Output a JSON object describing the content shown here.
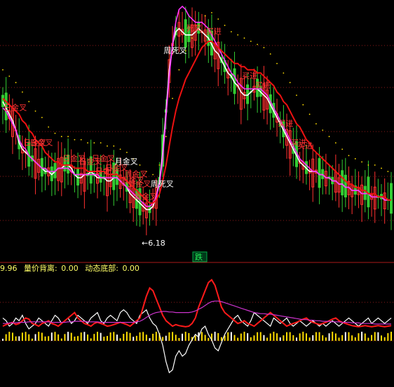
{
  "colors": {
    "background": "#000000",
    "grid": "#8b1a1a",
    "up_candle": "#ff3030",
    "down_candle": "#33cc33",
    "ma_white": "#ffffff",
    "ma_magenta": "#ff33ff",
    "ma_red": "#ee1111",
    "signal_dot": "#ffdd00",
    "panel_title": "#ffff66",
    "sell_box": "#00aa44",
    "label_red": "#ff3333",
    "label_white": "#ffffff"
  },
  "main_panel": {
    "low_value_label": "←6.18",
    "sell_badge": "跌",
    "signal_labels": [
      {
        "text": "日金叉",
        "color": "red"
      },
      {
        "text": "日金叉",
        "color": "red"
      },
      {
        "text": "日金叉",
        "color": "red"
      },
      {
        "text": "日金叉",
        "color": "red"
      },
      {
        "text": "日金叉",
        "color": "red"
      },
      {
        "text": "日金叉",
        "color": "red"
      },
      {
        "text": "日金叉",
        "color": "red"
      },
      {
        "text": "日金叉",
        "color": "red"
      },
      {
        "text": "月金叉",
        "color": "white"
      },
      {
        "text": "周金叉",
        "color": "red"
      },
      {
        "text": "周金叉",
        "color": "red"
      },
      {
        "text": "周金叉",
        "color": "red"
      },
      {
        "text": "周金叉",
        "color": "red"
      },
      {
        "text": "周死叉",
        "color": "white"
      },
      {
        "text": "周死叉",
        "color": "white"
      },
      {
        "text": "死叉",
        "color": "red"
      },
      {
        "text": "买进",
        "color": "red"
      },
      {
        "text": "买进",
        "color": "red"
      },
      {
        "text": "买进",
        "color": "red"
      },
      {
        "text": "买进",
        "color": "red"
      },
      {
        "text": "买进",
        "color": "red"
      },
      {
        "text": "买进",
        "color": "red"
      }
    ]
  },
  "sub_panel": {
    "header_prefix": "9.96",
    "indicator1_label": "量价背离:",
    "indicator1_value": "0.00",
    "indicator2_label": "动态底部:",
    "indicator2_value": "0.00"
  },
  "chart_data": [
    {
      "type": "line",
      "panel": "price",
      "ylim": [
        4.8,
        13.0
      ],
      "x": [
        0,
        1,
        2,
        3,
        4,
        5,
        6,
        7,
        8,
        9,
        10,
        11,
        12,
        13,
        14,
        15,
        16,
        17,
        18,
        19,
        20,
        21,
        22,
        23,
        24,
        25,
        26,
        27,
        28,
        29,
        30,
        31,
        32,
        33,
        34,
        35,
        36,
        37,
        38,
        39,
        40,
        41,
        42,
        43,
        44,
        45,
        46,
        47,
        48,
        49,
        50,
        51,
        52,
        53,
        54,
        55,
        56,
        57,
        58,
        59,
        60,
        61,
        62,
        63,
        64,
        65,
        66,
        67,
        68,
        69,
        70,
        71,
        72,
        73,
        74,
        75,
        76,
        77,
        78,
        79,
        80,
        81,
        82,
        83,
        84,
        85,
        86,
        87,
        88,
        89,
        90,
        91,
        92,
        93,
        94,
        95,
        96,
        97,
        98,
        99,
        100,
        101,
        102,
        103,
        104,
        105,
        106,
        107,
        108,
        109,
        110,
        111,
        112,
        113,
        114,
        115,
        116,
        117,
        118,
        119
      ],
      "series": [
        {
          "color": "white",
          "values": [
            9.8,
            9.6,
            9.4,
            9.2,
            8.9,
            8.5,
            8.3,
            8.2,
            8.1,
            8.0,
            7.9,
            7.8,
            7.7,
            7.6,
            7.6,
            7.5,
            7.6,
            7.7,
            7.7,
            7.8,
            7.8,
            7.7,
            7.5,
            7.4,
            7.4,
            7.5,
            7.5,
            7.6,
            7.5,
            7.4,
            7.4,
            7.4,
            7.3,
            7.3,
            7.4,
            7.4,
            7.3,
            7.2,
            7.1,
            6.9,
            6.8,
            6.7,
            6.6,
            6.5,
            6.4,
            6.4,
            6.5,
            6.8,
            7.3,
            8.2,
            9.5,
            10.8,
            11.6,
            12.0,
            12.1,
            12.0,
            11.9,
            11.9,
            11.9,
            12.0,
            12.1,
            12.0,
            11.9,
            11.8,
            11.6,
            11.4,
            11.3,
            11.1,
            10.9,
            10.7,
            10.6,
            10.4,
            10.3,
            10.1,
            10.0,
            10.0,
            10.1,
            10.2,
            10.2,
            10.1,
            10.0,
            9.9,
            9.7,
            9.5,
            9.3,
            9.1,
            8.9,
            8.7,
            8.5,
            8.3,
            8.1,
            7.9,
            7.8,
            7.7,
            7.6,
            7.6,
            7.6,
            7.5,
            7.5,
            7.4,
            7.4,
            7.3,
            7.3,
            7.2,
            7.2,
            7.1,
            7.1,
            7.0,
            7.0,
            7.0,
            6.9,
            6.9,
            6.9,
            6.8,
            6.8,
            6.8,
            6.8,
            6.7,
            6.7,
            6.7
          ]
        },
        {
          "color": "magenta",
          "values": [
            9.6,
            9.5,
            9.3,
            9.1,
            8.9,
            8.6,
            8.4,
            8.3,
            8.1,
            8.0,
            7.9,
            7.8,
            7.7,
            7.7,
            7.6,
            7.6,
            7.6,
            7.7,
            7.7,
            7.7,
            7.7,
            7.6,
            7.5,
            7.5,
            7.5,
            7.5,
            7.5,
            7.5,
            7.5,
            7.5,
            7.4,
            7.4,
            7.4,
            7.4,
            7.4,
            7.4,
            7.3,
            7.2,
            7.1,
            7.0,
            6.9,
            6.8,
            6.7,
            6.6,
            6.5,
            6.5,
            6.6,
            6.8,
            7.2,
            8.0,
            9.3,
            10.6,
            11.6,
            12.3,
            12.7,
            12.8,
            12.7,
            12.5,
            12.4,
            12.3,
            12.3,
            12.3,
            12.2,
            12.1,
            11.9,
            11.7,
            11.5,
            11.3,
            11.1,
            10.9,
            10.7,
            10.6,
            10.4,
            10.3,
            10.2,
            10.2,
            10.2,
            10.2,
            10.2,
            10.2,
            10.1,
            10.0,
            9.8,
            9.6,
            9.4,
            9.2,
            9.0,
            8.8,
            8.6,
            8.4,
            8.2,
            8.0,
            7.9,
            7.8,
            7.7,
            7.6,
            7.6,
            7.5,
            7.5,
            7.4,
            7.4,
            7.3,
            7.3,
            7.2,
            7.2,
            7.1,
            7.1,
            7.0,
            7.0,
            7.0,
            6.9,
            6.9,
            6.9,
            6.8,
            6.8,
            6.8,
            6.8,
            6.7,
            6.7,
            6.7
          ]
        },
        {
          "color": "red",
          "values": [
            9.9,
            9.8,
            9.7,
            9.6,
            9.5,
            9.4,
            9.2,
            9.1,
            8.9,
            8.8,
            8.6,
            8.5,
            8.4,
            8.2,
            8.1,
            8.0,
            7.9,
            7.9,
            7.8,
            7.8,
            7.8,
            7.8,
            7.7,
            7.7,
            7.7,
            7.7,
            7.6,
            7.6,
            7.6,
            7.6,
            7.6,
            7.6,
            7.5,
            7.5,
            7.5,
            7.5,
            7.4,
            7.4,
            7.3,
            7.2,
            7.1,
            7.0,
            6.9,
            6.8,
            6.7,
            6.6,
            6.6,
            6.7,
            6.9,
            7.3,
            7.8,
            8.4,
            9.0,
            9.5,
            9.9,
            10.2,
            10.5,
            10.7,
            10.9,
            11.1,
            11.3,
            11.5,
            11.6,
            11.7,
            11.7,
            11.6,
            11.5,
            11.4,
            11.3,
            11.2,
            11.1,
            11.0,
            11.0,
            10.9,
            10.9,
            10.8,
            10.8,
            10.8,
            10.7,
            10.7,
            10.6,
            10.5,
            10.4,
            10.3,
            10.1,
            10.0,
            9.8,
            9.7,
            9.5,
            9.3,
            9.1,
            9.0,
            8.8,
            8.6,
            8.5,
            8.3,
            8.2,
            8.1,
            8.0,
            7.9,
            7.8,
            7.7,
            7.6,
            7.5,
            7.4,
            7.3,
            7.2,
            7.2,
            7.1,
            7.1,
            7.0,
            7.0,
            6.9,
            6.9,
            6.9,
            6.8,
            6.8,
            6.8,
            6.7,
            6.7
          ]
        }
      ]
    },
    {
      "type": "line",
      "panel": "indicator",
      "ylim": [
        -100,
        100
      ],
      "x": [
        0,
        1,
        2,
        3,
        4,
        5,
        6,
        7,
        8,
        9,
        10,
        11,
        12,
        13,
        14,
        15,
        16,
        17,
        18,
        19,
        20,
        21,
        22,
        23,
        24,
        25,
        26,
        27,
        28,
        29,
        30,
        31,
        32,
        33,
        34,
        35,
        36,
        37,
        38,
        39,
        40,
        41,
        42,
        43,
        44,
        45,
        46,
        47,
        48,
        49,
        50,
        51,
        52,
        53,
        54,
        55,
        56,
        57,
        58,
        59,
        60,
        61,
        62,
        63,
        64,
        65,
        66,
        67,
        68,
        69,
        70,
        71,
        72,
        73,
        74,
        75,
        76,
        77,
        78,
        79,
        80,
        81,
        82,
        83,
        84,
        85,
        86,
        87,
        88,
        89,
        90,
        91,
        92,
        93,
        94,
        95,
        96,
        97,
        98,
        99,
        100,
        101,
        102,
        103,
        104,
        105,
        106,
        107,
        108,
        109,
        110,
        111,
        112,
        113,
        114,
        115,
        116,
        117,
        118,
        119
      ],
      "series": [
        {
          "color": "white",
          "values": [
            20,
            15,
            5,
            10,
            20,
            15,
            25,
            10,
            0,
            5,
            10,
            20,
            15,
            10,
            5,
            15,
            25,
            20,
            10,
            15,
            20,
            10,
            15,
            25,
            20,
            15,
            10,
            20,
            25,
            30,
            15,
            10,
            20,
            25,
            20,
            15,
            30,
            35,
            30,
            20,
            15,
            10,
            25,
            30,
            35,
            20,
            10,
            5,
            -10,
            -30,
            -60,
            -80,
            -75,
            -50,
            -40,
            -50,
            -45,
            -30,
            -20,
            -10,
            -15,
            0,
            5,
            -10,
            -20,
            -35,
            -40,
            -25,
            -10,
            0,
            10,
            20,
            25,
            15,
            10,
            5,
            15,
            30,
            25,
            20,
            15,
            10,
            5,
            20,
            15,
            10,
            15,
            20,
            10,
            5,
            10,
            15,
            10,
            5,
            10,
            15,
            10,
            5,
            10,
            5,
            10,
            15,
            10,
            5,
            10,
            15,
            20,
            15,
            10,
            5,
            10,
            15,
            20,
            10,
            15,
            20,
            15,
            10,
            15,
            20
          ]
        },
        {
          "color": "red",
          "values": [
            5,
            8,
            10,
            12,
            8,
            10,
            15,
            20,
            18,
            10,
            8,
            5,
            10,
            12,
            15,
            10,
            8,
            5,
            10,
            15,
            20,
            25,
            30,
            20,
            15,
            10,
            8,
            5,
            10,
            12,
            10,
            8,
            5,
            6,
            8,
            10,
            12,
            10,
            8,
            5,
            10,
            15,
            20,
            40,
            60,
            75,
            70,
            55,
            40,
            25,
            15,
            10,
            5,
            8,
            6,
            5,
            4,
            5,
            10,
            20,
            40,
            55,
            70,
            85,
            90,
            80,
            60,
            40,
            30,
            25,
            20,
            15,
            10,
            12,
            15,
            10,
            8,
            5,
            10,
            15,
            20,
            25,
            30,
            25,
            20,
            15,
            10,
            5,
            8,
            10,
            12,
            15,
            18,
            20,
            15,
            12,
            10,
            8,
            10,
            12,
            15,
            18,
            20,
            15,
            12,
            10,
            8,
            6,
            5,
            4,
            5,
            6,
            5,
            4,
            5,
            6,
            5,
            4,
            5,
            6
          ]
        },
        {
          "color": "magenta",
          "values": [
            10,
            10,
            11,
            11,
            11,
            12,
            12,
            12,
            13,
            13,
            13,
            13,
            13,
            13,
            13,
            12,
            12,
            12,
            12,
            12,
            13,
            13,
            14,
            14,
            14,
            14,
            13,
            13,
            13,
            13,
            12,
            12,
            12,
            12,
            12,
            12,
            12,
            12,
            12,
            12,
            12,
            13,
            14,
            17,
            21,
            25,
            28,
            30,
            31,
            32,
            32,
            31,
            31,
            30,
            30,
            30,
            30,
            30,
            31,
            33,
            36,
            39,
            43,
            47,
            50,
            51,
            51,
            50,
            48,
            46,
            44,
            42,
            40,
            38,
            36,
            34,
            32,
            30,
            29,
            28,
            28,
            27,
            27,
            26,
            25,
            24,
            23,
            22,
            21,
            20,
            19,
            18,
            17,
            17,
            16,
            16,
            15,
            15,
            14,
            14,
            14,
            13,
            13,
            13,
            12,
            12,
            12,
            11,
            11,
            11,
            10,
            10,
            10,
            10,
            9,
            9,
            9,
            9,
            9,
            9
          ]
        }
      ]
    }
  ]
}
